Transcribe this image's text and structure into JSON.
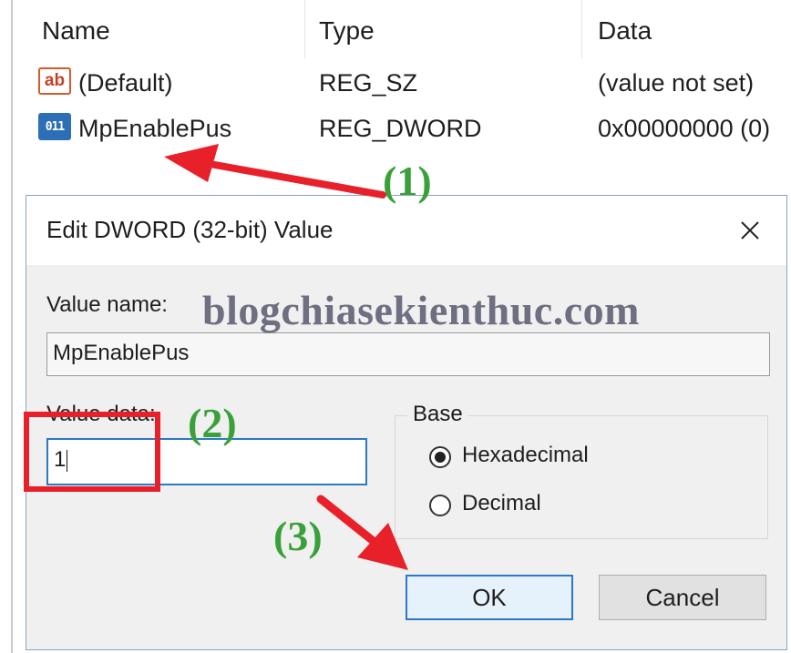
{
  "registry": {
    "columns": [
      "Name",
      "Type",
      "Data"
    ],
    "rows": [
      {
        "icon": "string-value-icon",
        "name": "(Default)",
        "type": "REG_SZ",
        "data": "(value not set)"
      },
      {
        "icon": "binary-value-icon",
        "name": "MpEnablePus",
        "type": "REG_DWORD",
        "data": "0x00000000 (0)"
      }
    ]
  },
  "dialog": {
    "title": "Edit DWORD (32-bit) Value",
    "value_name_label": "Value name:",
    "value_name": "MpEnablePus",
    "value_data_label": "Value data:",
    "value_data": "1",
    "base_label": "Base",
    "base_options": [
      {
        "label": "Hexadecimal",
        "checked": true
      },
      {
        "label": "Decimal",
        "checked": false
      }
    ],
    "ok_label": "OK",
    "cancel_label": "Cancel"
  },
  "annotations": {
    "watermark": "blogchiasekienthuc.com",
    "steps": [
      "(1)",
      "(2)",
      "(3)"
    ],
    "arrow_color": "#e8202a",
    "step_color": "#3aa13a"
  }
}
